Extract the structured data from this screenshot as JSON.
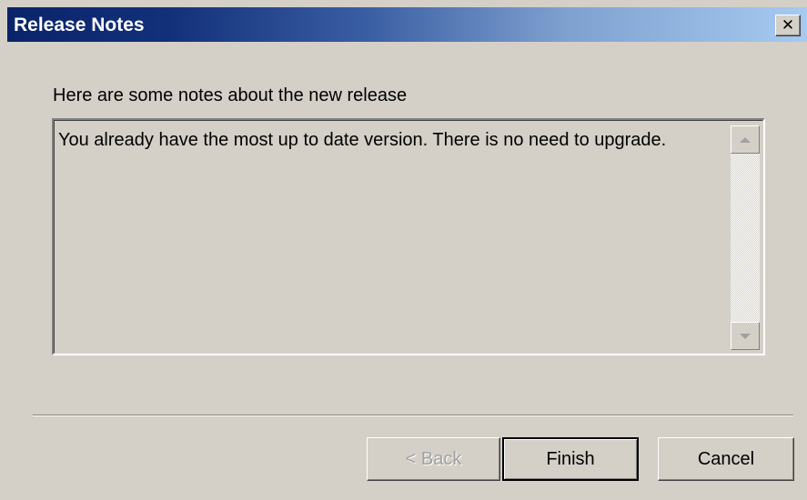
{
  "window": {
    "title": "Release Notes",
    "close_glyph": "✕"
  },
  "content": {
    "intro": "Here are some notes about the new release",
    "notes": "You already have the most up to date version.  There is no need to upgrade."
  },
  "buttons": {
    "back_label": "< Back",
    "finish_label": "Finish",
    "cancel_label": "Cancel"
  },
  "colors": {
    "title_gradient_start": "#0a246a",
    "title_gradient_end": "#a6caf0",
    "face": "#d4d0c8"
  }
}
